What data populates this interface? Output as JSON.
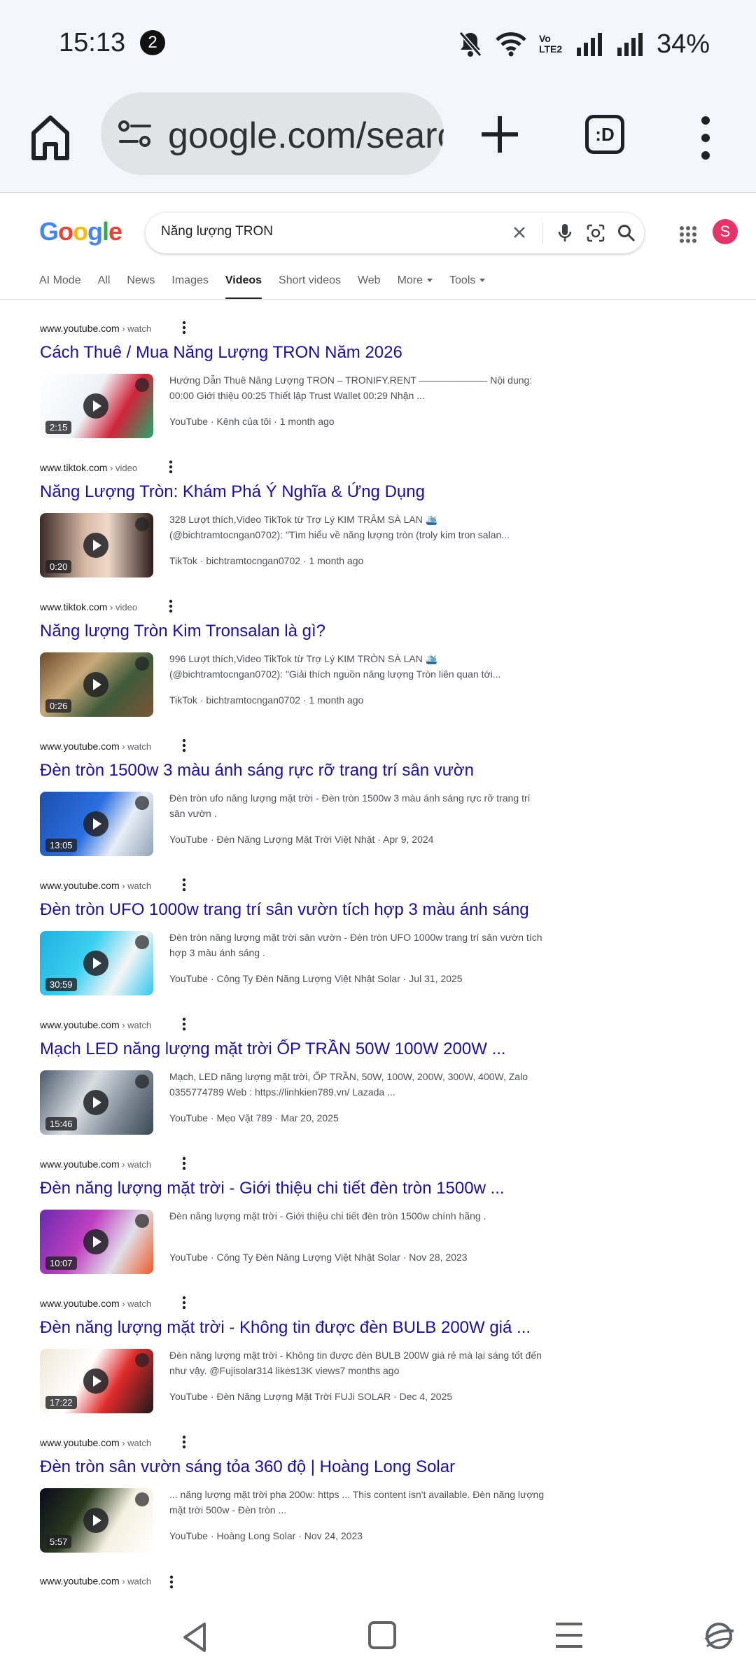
{
  "status": {
    "time": "15:13",
    "notif_count": "2",
    "network_label": "Vo LTE2",
    "battery": "34%"
  },
  "browser": {
    "url": "google.com/search",
    "tabs_label": ":D"
  },
  "google": {
    "logo": [
      "G",
      "o",
      "o",
      "g",
      "l",
      "e"
    ],
    "query": "Năng lượng TRON",
    "avatar_letter": "S",
    "tabs": [
      {
        "label": "AI Mode"
      },
      {
        "label": "All"
      },
      {
        "label": "News"
      },
      {
        "label": "Images"
      },
      {
        "label": "Videos"
      },
      {
        "label": "Short videos"
      },
      {
        "label": "Web"
      },
      {
        "label": "More"
      },
      {
        "label": "Tools"
      }
    ]
  },
  "results": [
    {
      "domain": "www.youtube.com",
      "path": " › watch",
      "title": "Cách Thuê / Mua Năng Lượng TRON Năm 2026",
      "duration": "2:15",
      "snippet": "Hướng Dẫn Thuê Năng Lượng TRON – TRONIFY.RENT ——————— Nội dung: 00:00 Giới thiệu 00:25 Thiết lập Trust Wallet 00:29 Nhận ...",
      "meta": "YouTube · Kênh của tôi · 1 month ago"
    },
    {
      "domain": "www.tiktok.com",
      "path": " › video",
      "title": "Năng Lượng Tròn: Khám Phá Ý Nghĩa & Ứng Dụng",
      "duration": "0:20",
      "snippet": "328 Lượt thích,Video TikTok từ Trợ Lý KIM TRÂM SÀ LAN 🛳️ (@bichtramtocngan0702): \"Tìm hiểu về năng lượng tròn (troly kim tron salan...",
      "meta": "TikTok · bichtramtocngan0702 · 1 month ago"
    },
    {
      "domain": "www.tiktok.com",
      "path": " › video",
      "title": "Năng lượng Tròn Kim Tronsalan là gì?",
      "duration": "0:26",
      "snippet": "996 Lượt thích,Video TikTok từ Trợ Lý KIM TRÒN SÀ LAN 🛳️ (@bichtramtocngan0702): \"Giải thích nguồn năng lượng Tròn liên quan tới...",
      "meta": "TikTok · bichtramtocngan0702 · 1 month ago"
    },
    {
      "domain": "www.youtube.com",
      "path": " › watch",
      "title": "Đèn tròn 1500w 3 màu ánh sáng rực rỡ trang trí sân vườn",
      "duration": "13:05",
      "snippet": "Đèn tròn ufo năng lượng mặt trời - Đèn tròn 1500w 3 màu ánh sáng rực rỡ trang trí sân vườn .",
      "meta": "YouTube · Đèn Năng Lượng Mặt Trời Việt Nhật · Apr 9, 2024"
    },
    {
      "domain": "www.youtube.com",
      "path": " › watch",
      "title": "Đèn tròn UFO 1000w trang trí sân vườn tích hợp 3 màu ánh sáng",
      "duration": "30:59",
      "snippet": "Đèn tròn năng lượng mặt trời sân vườn - Đèn tròn UFO 1000w trang trí sân vườn tích hợp 3 màu ánh sáng .",
      "meta": "YouTube · Công Ty Đèn Năng Lượng Việt Nhật Solar · Jul 31, 2025"
    },
    {
      "domain": "www.youtube.com",
      "path": " › watch",
      "title": "Mạch LED năng lượng mặt trời ỐP TRẦN 50W 100W 200W ...",
      "duration": "15:46",
      "snippet": "Mạch, LED năng lượng mặt trời, ỐP TRẦN, 50W, 100W, 200W, 300W, 400W, Zalo 0355774789 Web : https://linhkien789.vn/ Lazada ...",
      "meta": "YouTube · Mẹo Vặt 789 · Mar 20, 2025"
    },
    {
      "domain": "www.youtube.com",
      "path": " › watch",
      "title": "Đèn năng lượng mặt trời - Giới thiệu chi tiết đèn tròn 1500w ...",
      "duration": "10:07",
      "snippet": "Đèn năng lượng mặt trời - Giới thiệu chi tiết đèn tròn 1500w chính hãng .",
      "meta": "YouTube · Công Ty Đèn Năng Lượng Việt Nhật Solar · Nov 28, 2023"
    },
    {
      "domain": "www.youtube.com",
      "path": " › watch",
      "title": "Đèn năng lượng mặt trời - Không tin được đèn BULB 200W giá ...",
      "duration": "17:22",
      "snippet": "Đèn năng lượng mặt trời - Không tin được đèn BULB 200W giá rẻ mà lại sáng tốt đến như vậy. @Fujisolar314 likes13K views7 months ago",
      "meta": "YouTube · Đèn Năng Lượng Mặt Trời FUJi SOLAR · Dec 4, 2025"
    },
    {
      "domain": "www.youtube.com",
      "path": " › watch",
      "title": "Đèn tròn sân vườn sáng tỏa 360 độ | Hoàng Long Solar",
      "duration": "5:57",
      "snippet": "... năng lượng mặt trời pha 200w: https ... This content isn't available. Đèn năng lượng mặt trời 500w - Đèn tròn ...",
      "meta": "YouTube · Hoàng Long Solar · Nov 24, 2023"
    }
  ],
  "partial_result": {
    "domain": "www.youtube.com",
    "path": " › watch"
  }
}
